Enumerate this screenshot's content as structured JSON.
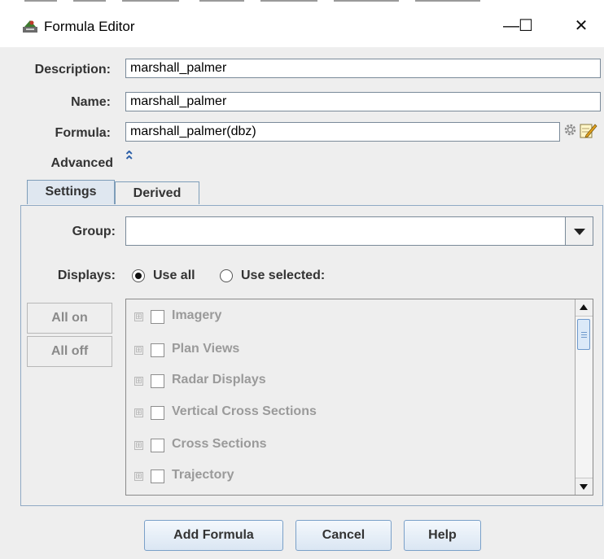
{
  "window": {
    "title": "Formula Editor",
    "minimize": "—",
    "maximize": "☐",
    "close": "✕"
  },
  "form": {
    "description_label": "Description:",
    "description_value": "marshall_palmer",
    "name_label": "Name:",
    "name_value": "marshall_palmer",
    "formula_label": "Formula:",
    "formula_value": "marshall_palmer(dbz)",
    "advanced_label": "Advanced",
    "advanced_toggle": "⌃"
  },
  "tabs": [
    {
      "label": "Settings",
      "selected": true
    },
    {
      "label": "Derived",
      "selected": false
    }
  ],
  "settings": {
    "group_label": "Group:",
    "group_value": "",
    "displays_label": "Displays:",
    "use_all_label": "Use all",
    "use_selected_label": "Use selected:",
    "selected_option": "Use all",
    "all_on_label": "All on",
    "all_off_label": "All off",
    "display_items": [
      "Imagery",
      "Plan Views",
      "Radar Displays",
      "Vertical Cross Sections",
      "Cross Sections",
      "Trajectory"
    ]
  },
  "buttons": {
    "add_formula": "Add Formula",
    "cancel": "Cancel",
    "help": "Help"
  },
  "icons": {
    "app": "formula-editor-app-icon",
    "formula_settings": "gear-icon",
    "formula_edit": "edit-icon",
    "expander": "⊞"
  },
  "colors": {
    "accent_border": "#7aa0c8",
    "tab_selected_bg": "#dfe7f0",
    "window_bg": "#eeeeee"
  }
}
